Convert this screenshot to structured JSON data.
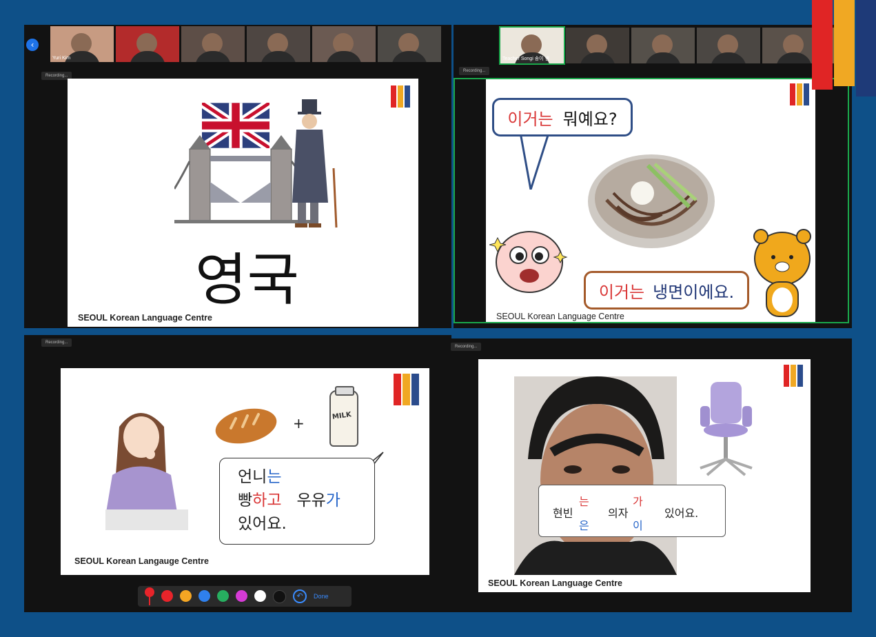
{
  "header": {
    "brand_logo_icon": "brand-logo-icon"
  },
  "top_left": {
    "participants": [
      {
        "name": "Yuri Kim",
        "color": "#c79b82"
      },
      {
        "name": "",
        "color": "#b32b2b"
      },
      {
        "name": "",
        "color": "#5d4e47"
      },
      {
        "name": "",
        "color": "#4e4642"
      },
      {
        "name": "",
        "color": "#6b5a52"
      },
      {
        "name": "",
        "color": "#4d4a46"
      }
    ],
    "recording": "Recording...",
    "slide": {
      "title": "영국",
      "credit": "SEOUL Korean Language Centre"
    }
  },
  "top_right": {
    "participants": [
      {
        "name": "Teacher Songi 송이 쌤",
        "color": "#ece7dd"
      },
      {
        "name": "",
        "color": "#3f3a36"
      },
      {
        "name": "",
        "color": "#55504a"
      },
      {
        "name": "",
        "color": "#4b4743"
      },
      {
        "name": "",
        "color": "#5a514a"
      },
      {
        "name": "",
        "color": "#7c6b48"
      }
    ],
    "recording": "Recording...",
    "slide": {
      "question_part1": "이거는",
      "question_part2": "뭐예요?",
      "answer_part1": "이거는",
      "answer_part2": "냉면이에요.",
      "credit": "SEOUL Korean Language Centre"
    }
  },
  "bottom_left": {
    "recording": "Recording...",
    "slide": {
      "plus": "+",
      "milk_label": "MILK",
      "line1a": "언니",
      "line1b": "는",
      "line2a": "빵",
      "line2b": "하고",
      "line2c": "우유",
      "line2d": "가",
      "line3": "있어요.",
      "credit": "SEOUL Korean Langauge Centre"
    },
    "annotation_toolbar": {
      "colors": [
        "#e8242a",
        "#f5a623",
        "#2f80ed",
        "#27ae60",
        "#d63bd6",
        "#ffffff",
        "#111111"
      ],
      "done_label": "Done"
    }
  },
  "bottom_right": {
    "recording": "Recording...",
    "slide": {
      "word1": "현빈",
      "particle1_top": "는",
      "particle1_bottom": "은",
      "word2": "의자",
      "particle2_top": "가",
      "particle2_bottom": "이",
      "word3": "있어요.",
      "credit": "SEOUL Korean Language Centre"
    }
  }
}
